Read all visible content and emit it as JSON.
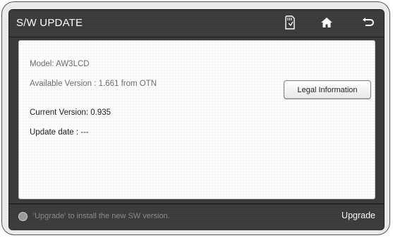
{
  "header": {
    "title": "S/W UPDATE",
    "icons": [
      "sd-card-icon",
      "home-icon",
      "back-icon"
    ]
  },
  "info": {
    "model": "Model: AW3LCD",
    "available_version": "Available Version : 1.661 from OTN",
    "current_version": "Current Version: 0.935",
    "update_date": "Update date : ---"
  },
  "buttons": {
    "legal_information": "Legal Information",
    "upgrade": "Upgrade"
  },
  "footer": {
    "hint": "'Upgrade' to install the new SW version."
  },
  "colors": {
    "bar_dark": "#2e2e2e",
    "content_bg": "#fdfdfd",
    "text_muted": "#6c6c6c",
    "text_dark": "#1e1e1e"
  }
}
